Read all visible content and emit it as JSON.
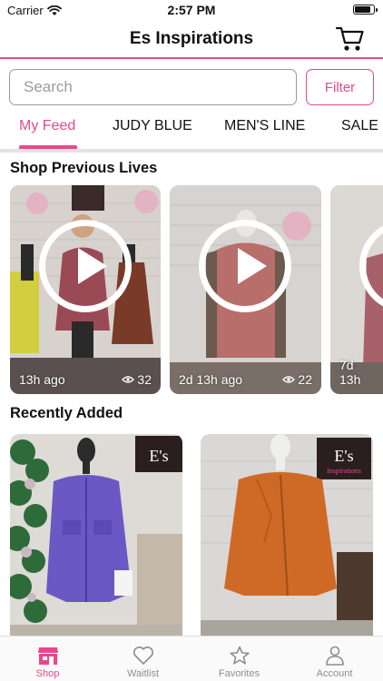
{
  "status_bar": {
    "carrier": "Carrier",
    "time": "2:57 PM",
    "battery_level": 0.9
  },
  "header": {
    "title": "Es Inspirations",
    "cart_icon": "cart-icon"
  },
  "search": {
    "placeholder": "Search",
    "value": "",
    "filter_label": "Filter"
  },
  "category_tabs": {
    "selected": "My Feed",
    "items": [
      {
        "label": "My Feed"
      },
      {
        "label": "JUDY BLUE"
      },
      {
        "label": "MEN'S LINE"
      },
      {
        "label": "SALE"
      }
    ]
  },
  "previous_lives": {
    "title": "Shop Previous Lives",
    "items": [
      {
        "time_ago": "13h ago",
        "views": "32"
      },
      {
        "time_ago": "2d 13h ago",
        "views": "22"
      },
      {
        "time_ago": "7d 13h",
        "views": ""
      }
    ]
  },
  "recently_added": {
    "title": "Recently Added",
    "items": [
      {
        "sign_text": "E's"
      },
      {
        "sign_text": "E's",
        "sign_subtext": "Inspirations"
      }
    ]
  },
  "tab_bar": {
    "selected": "Shop",
    "items": [
      {
        "label": "Shop",
        "icon": "shop-icon"
      },
      {
        "label": "Waitlist",
        "icon": "heart-icon"
      },
      {
        "label": "Favorites",
        "icon": "star-icon"
      },
      {
        "label": "Account",
        "icon": "person-icon"
      }
    ]
  },
  "colors": {
    "accent": "#e8488c",
    "inactive": "#8e8e93"
  }
}
